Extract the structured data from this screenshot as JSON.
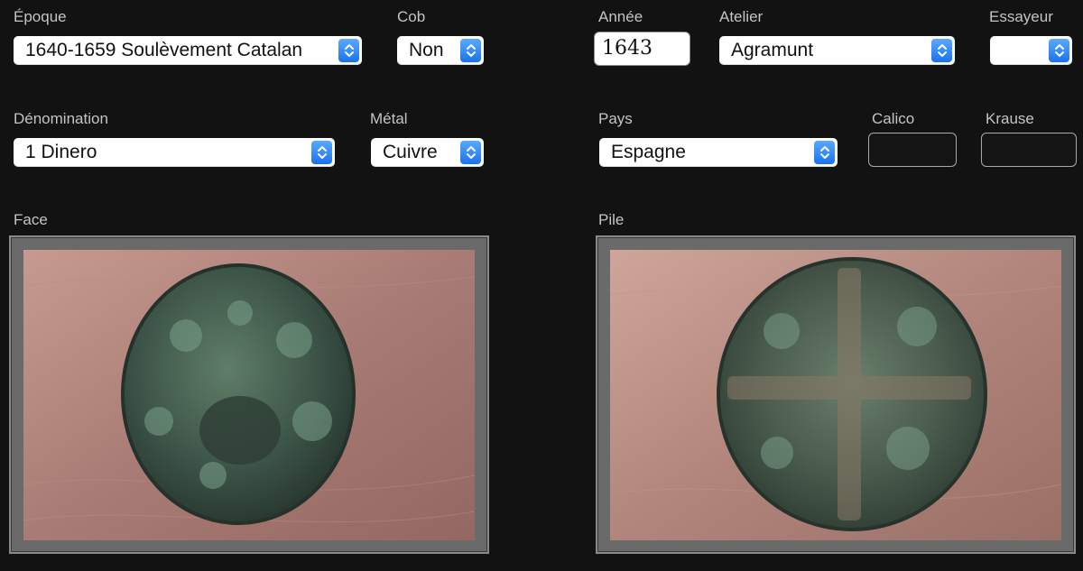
{
  "fields": {
    "epoque": {
      "label": "Époque",
      "value": "1640-1659 Soulèvement Catalan"
    },
    "cob": {
      "label": "Cob",
      "value": "Non"
    },
    "annee": {
      "label": "Année",
      "value": "1643"
    },
    "atelier": {
      "label": "Atelier",
      "value": "Agramunt"
    },
    "essayeur": {
      "label": "Essayeur",
      "value": ""
    },
    "denomination": {
      "label": "Dénomination",
      "value": "1 Dinero"
    },
    "metal": {
      "label": "Métal",
      "value": "Cuivre"
    },
    "pays": {
      "label": "Pays",
      "value": "Espagne"
    },
    "calico": {
      "label": "Calico",
      "value": ""
    },
    "krause": {
      "label": "Krause",
      "value": ""
    }
  },
  "images": {
    "face": {
      "label": "Face"
    },
    "pile": {
      "label": "Pile"
    }
  },
  "icons": {
    "stepper": "up-down-chevron-icon",
    "face_image": "coin-obverse-photo",
    "pile_image": "coin-reverse-photo"
  },
  "colors": {
    "background": "#121212",
    "accent": "#1b73ea",
    "label": "#c4c4c4"
  }
}
